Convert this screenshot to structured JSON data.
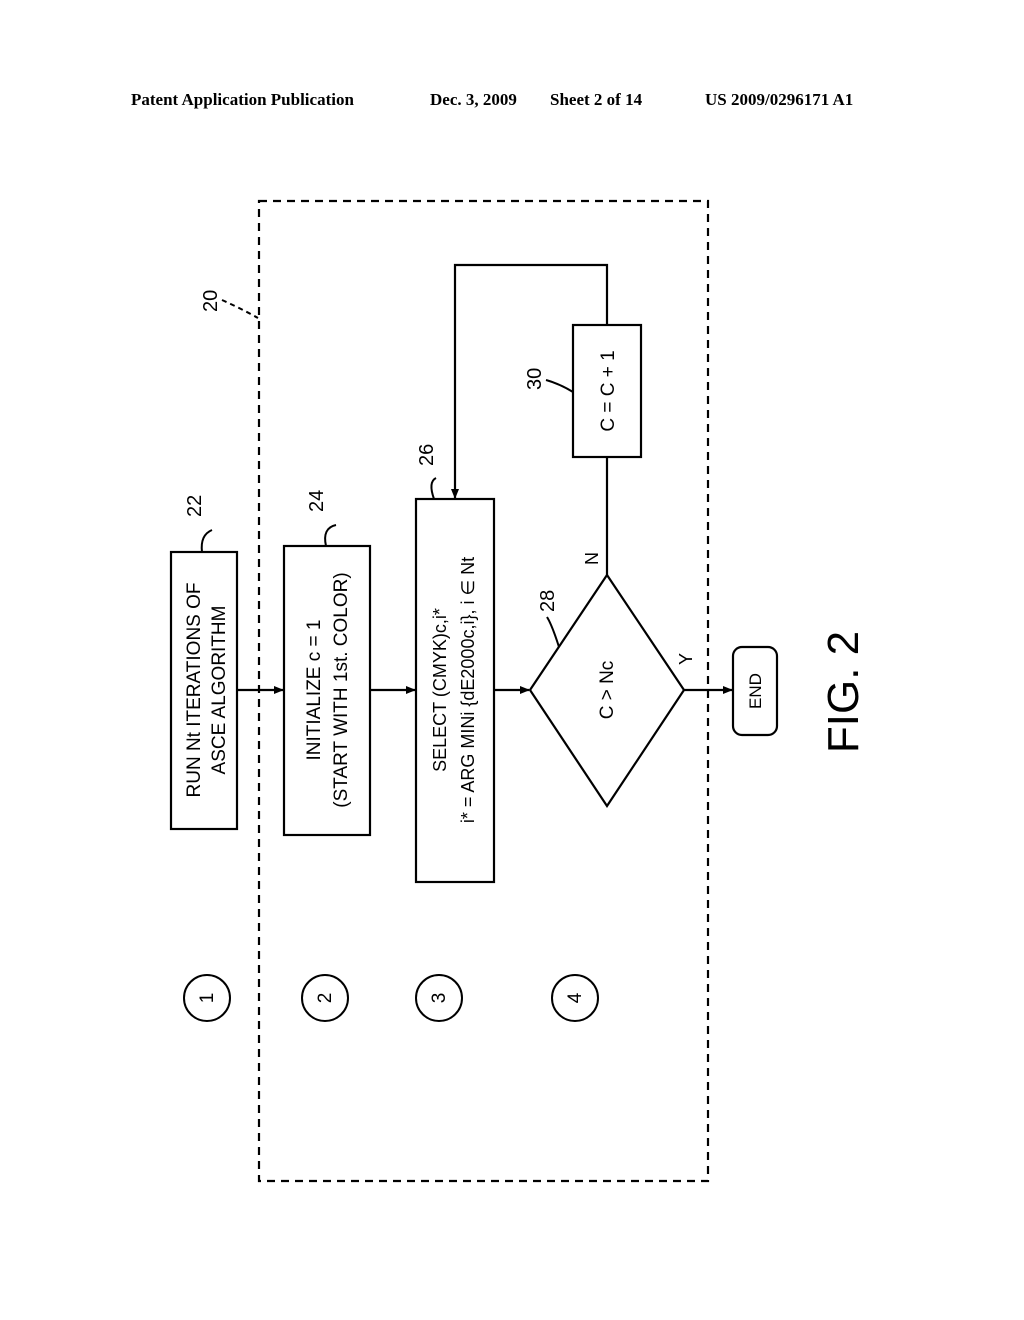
{
  "header": {
    "publication": "Patent Application Publication",
    "date": "Dec. 3, 2009",
    "sheet": "Sheet 2 of 14",
    "number": "US 2009/0296171 A1"
  },
  "figure": {
    "label": "FIG. 2",
    "container_ref": "20",
    "steps": [
      {
        "ref": "22",
        "line1": "RUN Nt ITERATIONS OF",
        "line2": "ASCE ALGORITHM"
      },
      {
        "ref": "24",
        "line1": "INITIALIZE c = 1",
        "line2": "(START WITH 1st. COLOR)"
      },
      {
        "ref": "26",
        "line1": "SELECT (CMYK)c,i*",
        "line2": "i* = ARG MINi {dE2000c,i}, i ∈ Nt"
      },
      {
        "ref": "28",
        "line1": "C > Nc"
      },
      {
        "ref": "30",
        "line1": "C = C + 1"
      }
    ],
    "end_label": "END",
    "yes_label": "Y",
    "no_label": "N",
    "stage_markers": [
      "1",
      "2",
      "3",
      "4"
    ]
  }
}
